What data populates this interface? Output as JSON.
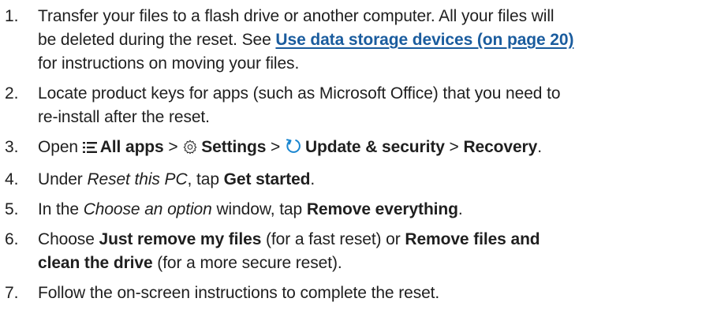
{
  "colors": {
    "text": "#1f1f1f",
    "link": "#1a5c9e",
    "update_icon": "#1a86d0"
  },
  "steps": [
    {
      "num": "1.",
      "line1": "Transfer your files to a flash drive or another computer. All your files will",
      "line2_pre": "be deleted during the reset. See ",
      "link": "Use data storage devices (on page 20)",
      "line3": "for instructions on moving your files."
    },
    {
      "num": "2.",
      "line1": "Locate product keys for apps (such as Microsoft Office) that you need to",
      "line2": "re-install after the reset."
    },
    {
      "num": "3.",
      "open": "Open ",
      "all_apps": "All apps",
      "sep1": " > ",
      "settings": "Settings",
      "sep2": " > ",
      "update_security": "Update & security",
      "sep3": " > ",
      "recovery": "Recovery",
      "end": ".",
      "icons": [
        "all-apps-icon",
        "settings-gear-icon",
        "update-refresh-icon"
      ]
    },
    {
      "num": "4.",
      "under": "Under ",
      "reset_pc": "Reset this PC",
      "tap": ", tap ",
      "get_started": "Get started",
      "end": "."
    },
    {
      "num": "5.",
      "in_the": "In the ",
      "choose_option": "Choose an option",
      "window_tap": " window, tap ",
      "remove_everything": "Remove everything",
      "end": "."
    },
    {
      "num": "6.",
      "choose": "Choose ",
      "just_remove": "Just remove my files",
      "fast_or": " (for a fast reset) or ",
      "remove_clean_1": "Remove files and",
      "remove_clean_2": "clean the drive",
      "secure": " (for a more secure reset)."
    },
    {
      "num": "7.",
      "text": "Follow the on-screen instructions to complete the reset."
    }
  ]
}
